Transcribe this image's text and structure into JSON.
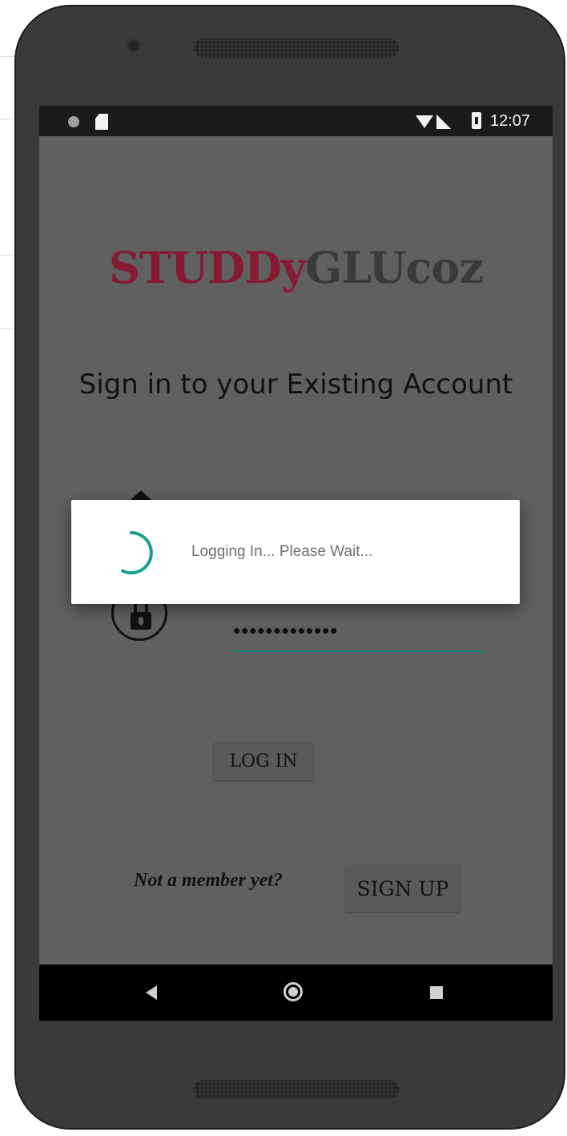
{
  "status_bar": {
    "time": "12:07"
  },
  "app": {
    "logo": {
      "part1": "STUDDy",
      "part2": "GLUcoz"
    },
    "subtitle": "Sign in to your Existing Account",
    "password_value": "•••••••••••••",
    "login_label": "LOG IN",
    "member_prompt": "Not a member yet?",
    "signup_label": "SIGN UP"
  },
  "dialog": {
    "message": "Logging In... Please Wait..."
  },
  "colors": {
    "accent": "#0a7f74",
    "logo_red": "#861a33",
    "spinner": "#17a08f"
  }
}
